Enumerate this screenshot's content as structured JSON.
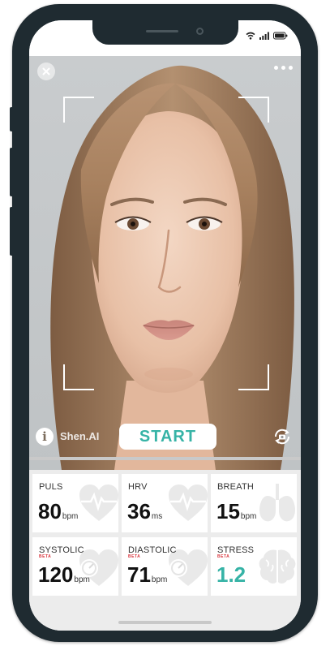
{
  "app": {
    "brand_label": "Shen.AI",
    "start_label": "START",
    "scan_progress": 0.0
  },
  "camera": {
    "subject": "face-portrait"
  },
  "metrics": [
    {
      "id": "puls",
      "label": "PULS",
      "beta": "",
      "value": "80",
      "unit": "bpm",
      "icon": "heart-pulse-icon",
      "accent": false
    },
    {
      "id": "hrv",
      "label": "HRV",
      "beta": "",
      "value": "36",
      "unit": "ms",
      "icon": "heart-pulse-icon",
      "accent": false
    },
    {
      "id": "breath",
      "label": "BREATH",
      "beta": "",
      "value": "15",
      "unit": "bpm",
      "icon": "lungs-icon",
      "accent": false
    },
    {
      "id": "systolic",
      "label": "SYSTOLIC",
      "beta": "BETA",
      "value": "120",
      "unit": "bpm",
      "icon": "heart-gauge-icon",
      "accent": false
    },
    {
      "id": "diastolic",
      "label": "DIASTOLIC",
      "beta": "BETA",
      "value": "71",
      "unit": "bpm",
      "icon": "heart-gauge-icon",
      "accent": false
    },
    {
      "id": "stress",
      "label": "STRESS",
      "beta": "BETA",
      "value": "1.2",
      "unit": "",
      "icon": "brain-icon",
      "accent": true
    }
  ],
  "colors": {
    "accent": "#36b3a6",
    "phone_frame": "#1f2b31",
    "beta_tag": "#d9363e"
  }
}
